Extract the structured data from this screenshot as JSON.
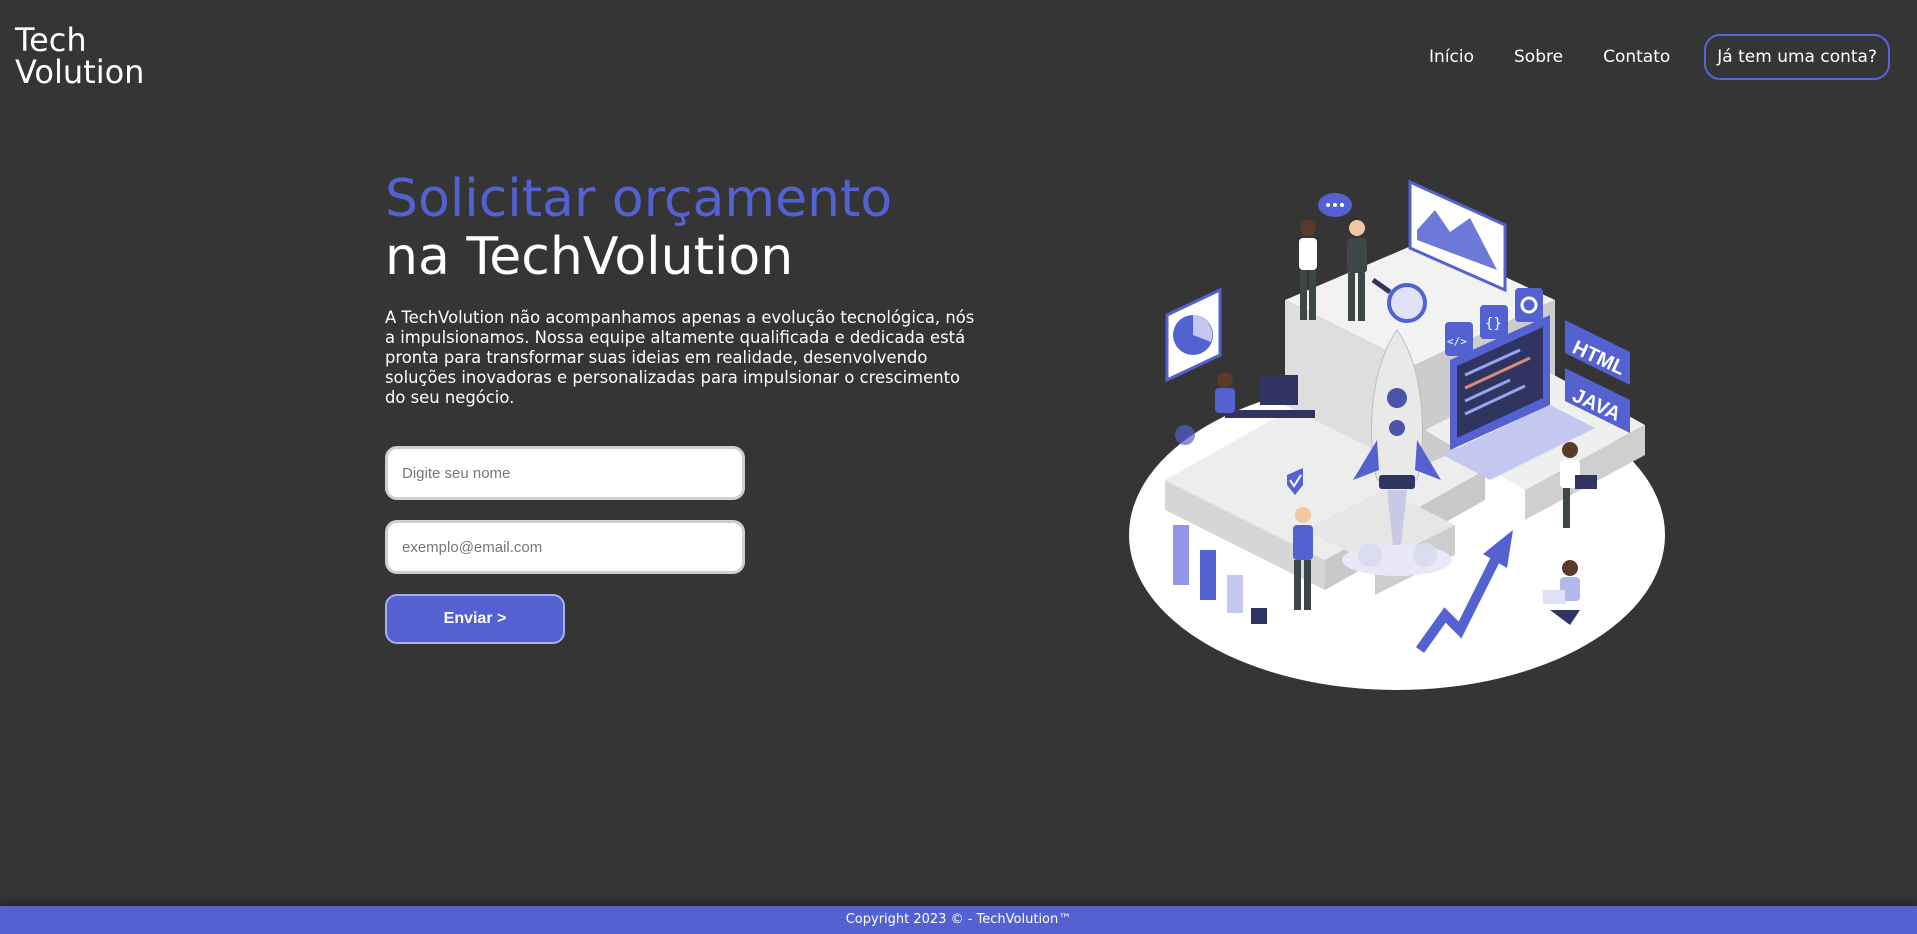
{
  "header": {
    "logo_line1": "Tech",
    "logo_line2": "Volution",
    "nav": {
      "home": "Início",
      "about": "Sobre",
      "contact": "Contato",
      "account": "Já tem uma conta?"
    }
  },
  "hero": {
    "title_accent": "Solicitar orçamento",
    "title_main": "na TechVolution",
    "description": "A TechVolution não acompanhamos apenas a evolução tecnológica, nós a impulsionamos. Nossa equipe altamente qualificada e dedicada está pronta para transformar suas ideias em realidade, desenvolvendo soluções inovadoras e personalizadas para impulsionar o crescimento do seu negócio.",
    "name_placeholder": "Digite seu nome",
    "email_placeholder": "exemplo@email.com",
    "submit_label": "Enviar >"
  },
  "illustration": {
    "code_tag_1": "HTML",
    "code_tag_2": "JAVA",
    "icon_names": [
      "rocket-icon",
      "gear-icon",
      "code-icon",
      "braces-icon",
      "magnifier-icon",
      "chart-icon",
      "check-icon"
    ]
  },
  "footer": {
    "copyright": "Copyright 2023 © - TechVolution™"
  },
  "colors": {
    "background": "#353535",
    "accent": "#5461d1",
    "footer": "#5461d1",
    "text": "#ffffff"
  }
}
